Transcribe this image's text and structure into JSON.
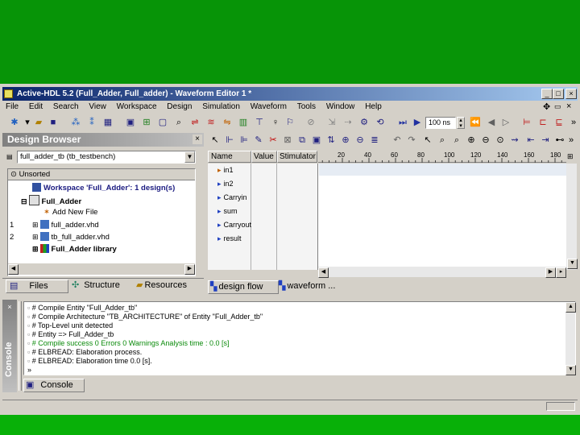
{
  "window": {
    "title": "Active-HDL 5.2 (Full_Adder, Full_adder) - Waveform Editor 1 *",
    "controls": {
      "minimize": "_",
      "maximize": "□",
      "close": "×"
    }
  },
  "menu": [
    "File",
    "Edit",
    "Search",
    "View",
    "Workspace",
    "Design",
    "Simulation",
    "Waveform",
    "Tools",
    "Window",
    "Help"
  ],
  "toolbar": {
    "time_value": "100 ns"
  },
  "design_browser": {
    "title": "Design Browser",
    "selector_value": "full_adder_tb (tb_testbench)",
    "unsorted_label": "Unsorted",
    "tree": [
      {
        "num": "",
        "label": "Workspace 'Full_Adder': 1 design(s)",
        "bold": true
      },
      {
        "num": "",
        "label": "Full_Adder",
        "bold": true
      },
      {
        "num": "",
        "label": "Add New File",
        "bold": false
      },
      {
        "num": "1",
        "label": "full_adder.vhd",
        "bold": false
      },
      {
        "num": "2",
        "label": "tb_full_adder.vhd",
        "bold": false
      },
      {
        "num": "",
        "label": "Full_Adder library",
        "bold": true
      }
    ],
    "tabs": [
      "Files",
      "Structure",
      "Resources"
    ]
  },
  "waveform": {
    "columns": {
      "name": "Name",
      "value": "Value",
      "stimulator": "Stimulator"
    },
    "ruler_ticks": [
      "20",
      "40",
      "60",
      "80",
      "100",
      "120",
      "140",
      "160",
      "180"
    ],
    "signals": [
      "in1",
      "in2",
      "Carryin",
      "sum",
      "Carryout",
      "result"
    ],
    "tabs": [
      "design flow",
      "waveform ..."
    ]
  },
  "console": {
    "side_label": "Console",
    "lines": [
      {
        "text": "# Compile Entity \"Full_Adder_tb\"",
        "color": "#000000"
      },
      {
        "text": "# Compile Architecture \"TB_ARCHITECTURE\" of Entity \"Full_Adder_tb\"",
        "color": "#000000"
      },
      {
        "text": "# Top-Level unit detected",
        "color": "#000000"
      },
      {
        "text": "# Entity => Full_Adder_tb",
        "color": "#000000"
      },
      {
        "text": "# Compile success 0 Errors 0 Warnings  Analysis time :  0.0 [s]",
        "color": "#0a8a0a"
      },
      {
        "text": "# ELBREAD: Elaboration process.",
        "color": "#000000"
      },
      {
        "text": "# ELBREAD: Elaboration time 0.0 [s].",
        "color": "#000000"
      },
      {
        "text": "»",
        "color": "#000000"
      }
    ],
    "tab": "Console"
  },
  "colors": {
    "desktop_green": "#079407",
    "window_face": "#d4d0c8",
    "title_blue": "#0a246a"
  }
}
